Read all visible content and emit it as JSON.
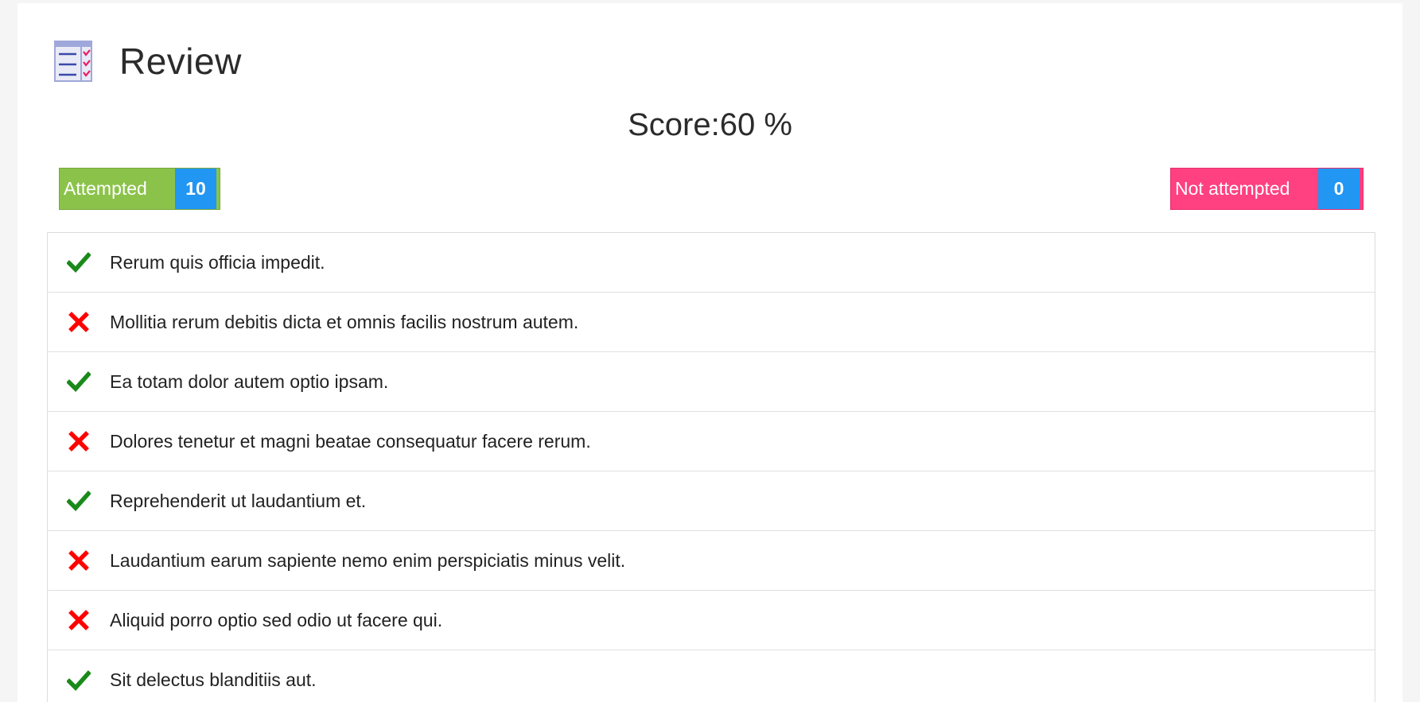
{
  "header": {
    "title": "Review",
    "icon": "checklist-icon"
  },
  "score": {
    "text": "Score:60 %",
    "value_percent": 60
  },
  "stats": {
    "attempted": {
      "label": "Attempted",
      "count": "10",
      "color": "#8bc34a"
    },
    "not_attempted": {
      "label": "Not attempted",
      "count": "0",
      "color": "#ff4081"
    },
    "count_badge_color": "#2196f3"
  },
  "questions": [
    {
      "text": "Rerum quis officia impedit.",
      "correct": true
    },
    {
      "text": "Mollitia rerum debitis dicta et omnis facilis nostrum autem.",
      "correct": false
    },
    {
      "text": "Ea totam dolor autem optio ipsam.",
      "correct": true
    },
    {
      "text": "Dolores tenetur et magni beatae consequatur facere rerum.",
      "correct": false
    },
    {
      "text": "Reprehenderit ut laudantium et.",
      "correct": true
    },
    {
      "text": "Laudantium earum sapiente nemo enim perspiciatis minus velit.",
      "correct": false
    },
    {
      "text": "Aliquid porro optio sed odio ut facere qui.",
      "correct": false
    },
    {
      "text": "Sit delectus blanditiis aut.",
      "correct": true
    }
  ],
  "colors": {
    "correct": "#1a8a1a",
    "incorrect": "#ff0000"
  }
}
